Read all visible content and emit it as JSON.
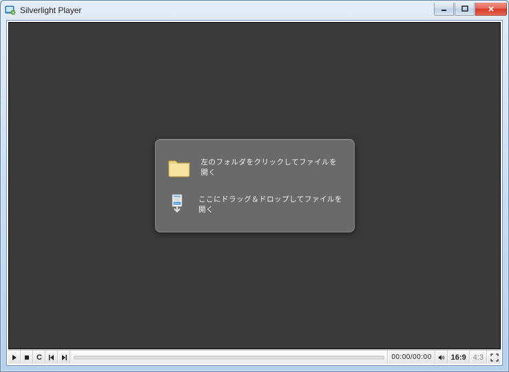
{
  "window": {
    "title": "Silverlight Player"
  },
  "dropPanel": {
    "openLabel": "左のフォルダをクリックしてファイルを開く",
    "dragLabel": "ここにドラッグ＆ドロップしてファイルを開く"
  },
  "controls": {
    "cycleLabel": "C",
    "time": "00:00/00:00",
    "ratio1": "16:9",
    "ratio2": "4:3"
  }
}
